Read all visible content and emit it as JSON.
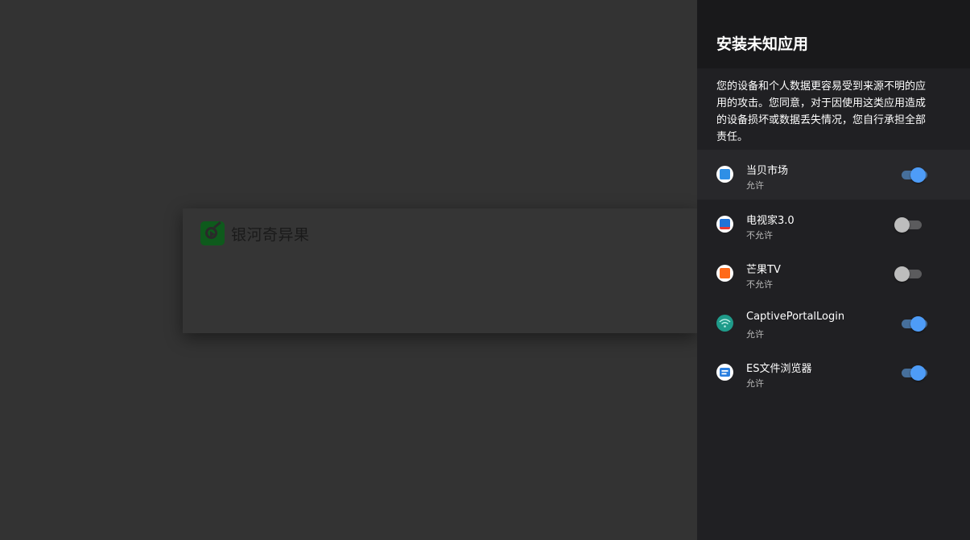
{
  "background": {
    "app_name": "银河奇异果",
    "app_icon": "play-tv-icon"
  },
  "panel": {
    "title": "安装未知应用",
    "description": "您的设备和个人数据更容易受到来源不明的应用的攻击。您同意，对于因使用这类应用造成的设备损坏或数据丢失情况，您自行承担全部责任。",
    "apps": [
      {
        "name": "当贝市场",
        "status": "允许",
        "enabled": true,
        "focused": true,
        "icon": "dangbei-market-icon",
        "color": "#2f8fe6"
      },
      {
        "name": "电视家3.0",
        "status": "不允许",
        "enabled": false,
        "focused": false,
        "icon": "dianshijia-icon",
        "color": "#1e73d8"
      },
      {
        "name": "芒果TV",
        "status": "不允许",
        "enabled": false,
        "focused": false,
        "icon": "mango-tv-icon",
        "color": "#ff6a1a"
      },
      {
        "name": "CaptivePortalLogin",
        "status": "允许",
        "enabled": true,
        "focused": false,
        "icon": "wifi-question-icon",
        "color": "#1f9b8a"
      },
      {
        "name": "ES文件浏览器",
        "status": "允许",
        "enabled": true,
        "focused": false,
        "icon": "es-file-explorer-icon",
        "color": "#2a7fe0"
      }
    ]
  }
}
